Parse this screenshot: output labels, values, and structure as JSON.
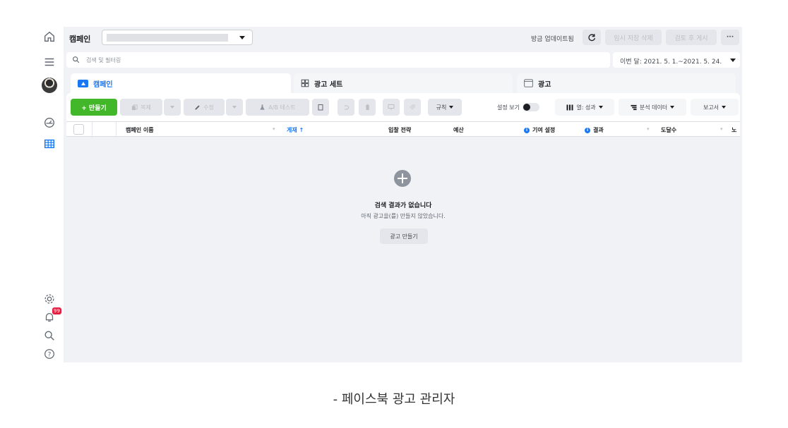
{
  "header": {
    "page_title": "캠페인",
    "status_text": "방금 업데이트됨",
    "discard_label": "임시 저장 삭제",
    "review_label": "검토 후 게시",
    "more_label": "···"
  },
  "search": {
    "placeholder": "검색 및 필터링"
  },
  "date_range": {
    "label": "이번 달: 2021. 5. 1.~2021. 5. 24."
  },
  "tabs": [
    {
      "label": "캠페인",
      "active": true
    },
    {
      "label": "광고 세트",
      "active": false
    },
    {
      "label": "광고",
      "active": false
    }
  ],
  "toolbar": {
    "create_label": "+ 만들기",
    "duplicate_label": "복제",
    "edit_label": "수정",
    "ab_test_label": "A/B 테스트",
    "rules_label": "규칙",
    "view_settings_label": "설정 보기",
    "columns_label": "열: 성과",
    "breakdown_label": "분석 데이터",
    "reports_label": "보고서"
  },
  "table": {
    "columns": [
      "캠페인 이름",
      "게재 ↑",
      "입찰 전략",
      "예산",
      "기여 설정",
      "결과",
      "도달수",
      "노"
    ]
  },
  "empty_state": {
    "title": "검색 결과가 없습니다",
    "subtitle": "아직 광고을(를) 만들지 않았습니다.",
    "button_label": "광고 만들기"
  },
  "sidebar": {
    "notification_count": "99"
  },
  "caption": "-   페이스북 광고 관리자",
  "colors": {
    "accent": "#1877f2",
    "create_green": "#42b72a",
    "background": "#f0f2f5"
  }
}
